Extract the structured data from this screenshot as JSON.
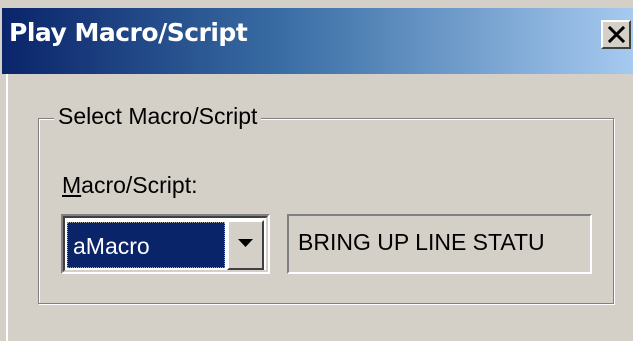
{
  "window": {
    "title": "Play Macro/Script",
    "close_label": "X"
  },
  "group": {
    "label": "Select Macro/Script"
  },
  "field": {
    "label_mnemonic": "M",
    "label_rest": "acro/Script:",
    "selected_value": "aMacro",
    "description": "BRING UP LINE STATU"
  },
  "icons": {
    "close": "close-icon",
    "dropdown": "dropdown-arrow-icon"
  },
  "colors": {
    "title_start": "#0a246a",
    "title_end": "#a6caf0",
    "dialog_face": "#d4d0c8",
    "selection": "#0a246a"
  }
}
